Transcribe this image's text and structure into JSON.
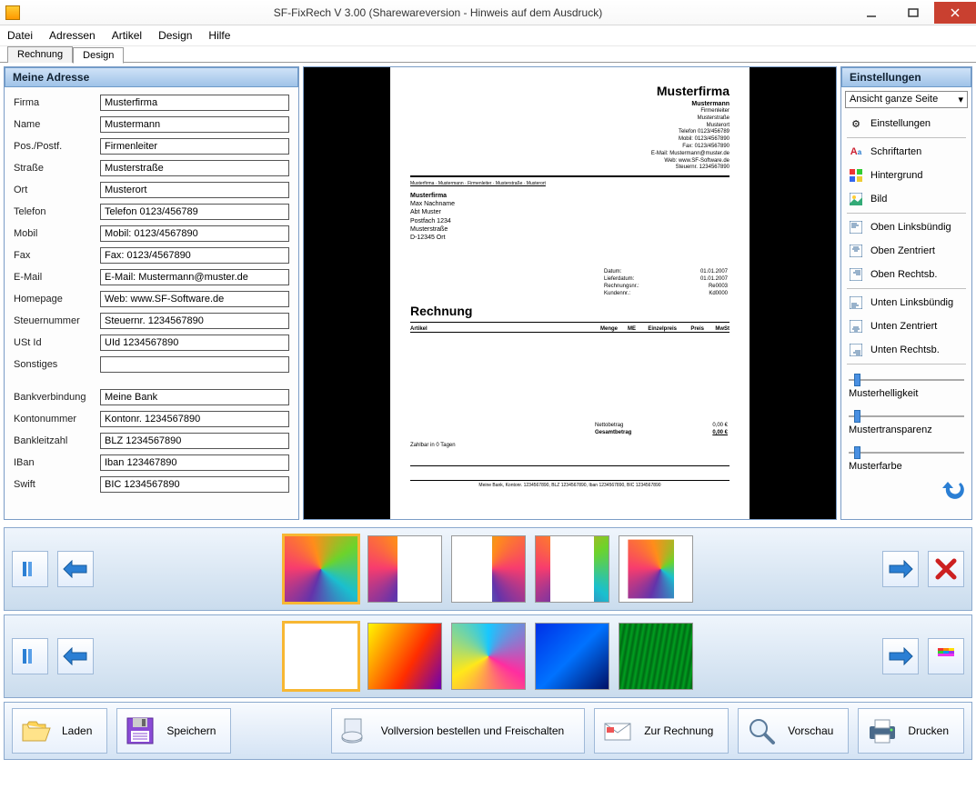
{
  "window": {
    "title": "SF-FixRech  V 3.00 (Sharewareversion - Hinweis auf dem Ausdruck)"
  },
  "menu": {
    "datei": "Datei",
    "adressen": "Adressen",
    "artikel": "Artikel",
    "design": "Design",
    "hilfe": "Hilfe"
  },
  "tabs": {
    "rechnung": "Rechnung",
    "design": "Design"
  },
  "left": {
    "header": "Meine Adresse",
    "labels": {
      "firma": "Firma",
      "name": "Name",
      "pos": "Pos./Postf.",
      "strasse": "Straße",
      "ort": "Ort",
      "telefon": "Telefon",
      "mobil": "Mobil",
      "fax": "Fax",
      "email": "E-Mail",
      "homepage": "Homepage",
      "steuernummer": "Steuernummer",
      "ustid": "USt Id",
      "sonstiges": "Sonstiges",
      "bankverbindung": "Bankverbindung",
      "kontonummer": "Kontonummer",
      "bankleitzahl": "Bankleitzahl",
      "iban": "IBan",
      "swift": "Swift"
    },
    "values": {
      "firma": "Musterfirma",
      "name": "Mustermann",
      "pos": "Firmenleiter",
      "strasse": "Musterstraße",
      "ort": "Musterort",
      "telefon": "Telefon 0123/456789",
      "mobil": "Mobil: 0123/4567890",
      "fax": "Fax: 0123/4567890",
      "email": "E-Mail: Mustermann@muster.de",
      "homepage": "Web: www.SF-Software.de",
      "steuernummer": "Steuernr. 1234567890",
      "ustid": "UId 1234567890",
      "sonstiges": "",
      "bankverbindung": "Meine Bank",
      "kontonummer": "Kontonr. 1234567890",
      "bankleitzahl": "BLZ 1234567890",
      "iban": "Iban 123467890",
      "swift": "BIC 1234567890"
    }
  },
  "preview": {
    "company": "Musterfirma",
    "company_lines": [
      "Mustermann",
      "Firmenleiter",
      "Musterstraße",
      "Musterort",
      "Telefon 0123/456789",
      "Mobil: 0123/4567890",
      "Fax: 0123/4567890",
      "E-Mail: Mustermann@muster.de",
      "Web: www.SF-Software.de",
      "Steuernr. 1234567890"
    ],
    "sender_line": "Musterfirma · Mustermann · Firmenleiter · Musterstraße · Musterort",
    "recipient_header": "Musterfirma",
    "recipient": [
      "Max Nachname",
      "Abt Muster",
      "Postfach 1234",
      "Musterstraße",
      "D-12345 Ort"
    ],
    "info": [
      [
        "Datum:",
        "01.01.2007"
      ],
      [
        "Lieferdatum:",
        "01.01.2007"
      ],
      [
        "Rechnungsnr.:",
        "Re0003"
      ],
      [
        "Kundennr.:",
        "Kd0000"
      ]
    ],
    "doc_title": "Rechnung",
    "columns": [
      "Artikel",
      "Menge",
      "ME",
      "Einzelpreis",
      "Preis",
      "MwSt"
    ],
    "totals": [
      [
        "Nettobetrag",
        "0,00 €"
      ],
      [
        "Gesamtbetrag",
        "0,00 €"
      ]
    ],
    "footer_note": "Zahlbar in 0 Tagen",
    "bank_line": "Meine Bank, Kontonr. 1234567890, BLZ 1234567890, Iban 1234567890, BIC 1234567890"
  },
  "right": {
    "header": "Einstellungen",
    "dropdown": "Ansicht ganze Seite",
    "items": {
      "einstellungen": "Einstellungen",
      "schriftarten": "Schriftarten",
      "hintergrund": "Hintergrund",
      "bild": "Bild",
      "ol": "Oben Linksbündig",
      "oz": "Oben Zentriert",
      "or": "Oben Rechtsb.",
      "ul": "Unten Linksbündig",
      "uz": "Unten Zentriert",
      "ur": "Unten Rechtsb."
    },
    "sliders": {
      "helligkeit": "Musterhelligkeit",
      "transparenz": "Mustertransparenz",
      "farbe": "Musterfarbe"
    }
  },
  "actions": {
    "laden": "Laden",
    "speichern": "Speichern",
    "vollversion": "Vollversion bestellen und Freischalten",
    "zur_rechnung": "Zur Rechnung",
    "vorschau": "Vorschau",
    "drucken": "Drucken"
  }
}
